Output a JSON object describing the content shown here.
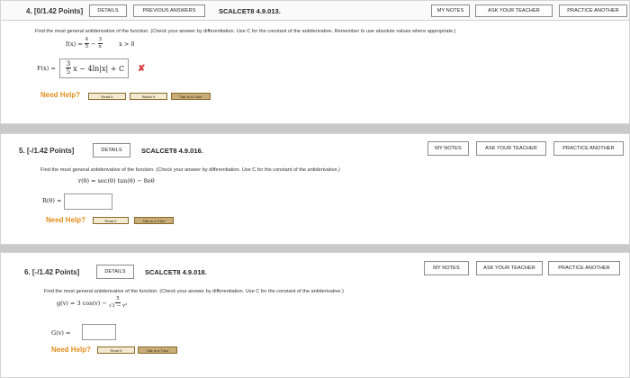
{
  "buttons": {
    "details": "DETAILS",
    "previous_answers": "PREVIOUS ANSWERS",
    "my_notes": "MY NOTES",
    "ask_teacher": "ASK YOUR TEACHER",
    "practice_another_q4": "PRACTICE ANOTHER",
    "practice_another": "PRACTICE ANOTHER"
  },
  "help": {
    "label": "Need Help?",
    "read_it": "Read It",
    "watch_it": "Watch It",
    "talk_tutor": "Talk to a Tutor"
  },
  "q4": {
    "number": "4. [0/1.42 Points]",
    "code": "SCALCET8 4.9.013.",
    "instructions": "Find the most general antiderivative of the function. (Check your answer by differentiation. Use C for the constant of the antiderivative. Remember to use absolute values where appropriate.)",
    "fn_lhs": "f(x) =",
    "fn_num1": "4",
    "fn_den1": "5",
    "fn_minus": "−",
    "fn_num2": "3",
    "fn_den2": "x",
    "fn_cond": "x > 0",
    "ans_lhs": "F(x) =",
    "ans_num": "3",
    "ans_den": "5",
    "ans_rest": "x − 4ln|x| + C",
    "status": "✘"
  },
  "q5": {
    "number": "5. [-/1.42 Points]",
    "code": "SCALCET8 4.9.016.",
    "instructions": "Find the most general antiderivative of the function. (Check your answer by differentiation. Use C for the constant of the antiderivative.)",
    "fn": "r(θ) = sec(θ) tan(θ) − 8eθ",
    "ans_lhs": "R(θ) ="
  },
  "q6": {
    "number": "6. [-/1.42 Points]",
    "code": "SCALCET8 4.9.018.",
    "instructions": "Find the most general antiderivative of the function. (Check your answer by differentiation. Use C for the constant of the antiderivative.)",
    "fn_lhs": "g(v) = 3 cos(v) −",
    "fn_num": "5",
    "fn_den": "√1 − v²",
    "ans_lhs": "G(v) ="
  }
}
